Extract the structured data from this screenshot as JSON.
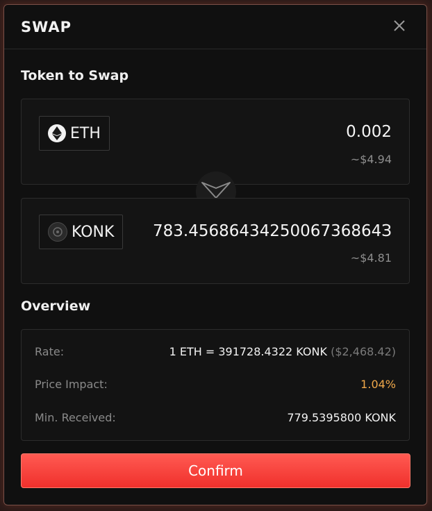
{
  "header": {
    "title": "SWAP",
    "close_icon": "close-icon"
  },
  "token_to_swap": {
    "section_title": "Token to Swap",
    "from": {
      "symbol": "ETH",
      "icon": "eth-icon",
      "amount": "0.002",
      "usd": "~$4.94"
    },
    "to": {
      "symbol": "KONK",
      "icon": "konk-icon",
      "amount": "783.4568643425006736864З",
      "usd": "~$4.81"
    },
    "swap_direction_icon": "swap-direction-icon"
  },
  "overview": {
    "section_title": "Overview",
    "rate": {
      "label": "Rate:",
      "value": "1 ETH = 391728.4322 KONK",
      "usd": "($2,468.42)"
    },
    "price_impact": {
      "label": "Price Impact:",
      "value": "1.04%",
      "color": "#f0a84a"
    },
    "min_received": {
      "label": "Min. Received:",
      "value": "779.5395800 KONK"
    }
  },
  "confirm_label": "Confirm",
  "colors": {
    "accent": "#f0302c",
    "background": "#101010"
  }
}
